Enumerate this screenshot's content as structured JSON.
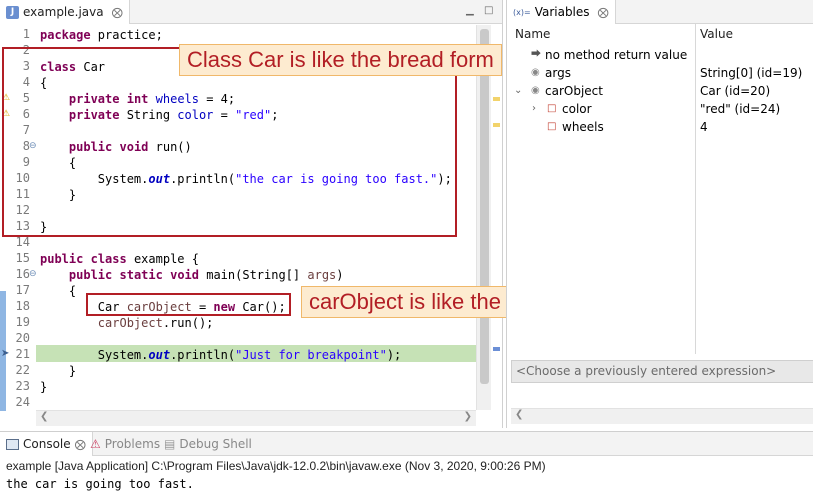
{
  "editor": {
    "tab_title": "example.java",
    "tab_close": "⨂",
    "line_numbers": [
      "1",
      "2",
      "3",
      "4",
      "5",
      "6",
      "7",
      "8",
      "9",
      "10",
      "11",
      "12",
      "13",
      "14",
      "15",
      "16",
      "17",
      "18",
      "19",
      "20",
      "21",
      "22",
      "23",
      "24"
    ],
    "code": {
      "l1": {
        "kw": "package",
        "rest": " practice;"
      },
      "l3": {
        "kw": "class",
        "rest": " Car"
      },
      "l4": {
        "text": "{"
      },
      "l5": {
        "kw1": "private",
        "kw2": "int",
        "fld": "wheels",
        "rest": " = 4;"
      },
      "l6": {
        "kw1": "private",
        "mid": " String ",
        "fld": "color",
        "eq": " = ",
        "str": "\"red\"",
        "end": ";"
      },
      "l8": {
        "kw1": "public",
        "kw2": "void",
        "rest": " run()"
      },
      "l9": {
        "text": "{"
      },
      "l10": {
        "pre": "System.",
        "sfld": "out",
        "mid": ".println(",
        "str": "\"the car is going too fast.\"",
        "end": ");"
      },
      "l11": {
        "text": "}"
      },
      "l13": {
        "text": "}"
      },
      "l15": {
        "kw1": "public",
        "kw2": "class",
        "rest": " example {"
      },
      "l16": {
        "kw1": "public",
        "kw2": "static",
        "kw3": "void",
        "mid": " main(String[] ",
        "lvar": "args",
        "end": ")"
      },
      "l17": {
        "text": "{"
      },
      "l18": {
        "pre": "Car ",
        "lvar": "carObject",
        "eq": " = ",
        "kw": "new",
        "end": " Car();"
      },
      "l19": {
        "lvar": "carObject",
        "end": ".run();"
      },
      "l21": {
        "pre": "System.",
        "sfld": "out",
        "mid": ".println(",
        "str": "\"Just for breakpoint\"",
        "end": ");"
      },
      "l22": {
        "text": "}"
      },
      "l23": {
        "text": "}"
      }
    },
    "annotations": {
      "class_label": "Class Car is like the bread form",
      "object_label": "carObject is like the bread"
    }
  },
  "variables": {
    "tab_title": "Variables",
    "tab_prefix": "(x)=",
    "col_name": "Name",
    "col_value": "Value",
    "rows": [
      {
        "name": "no method return value",
        "value": ""
      },
      {
        "name": "args",
        "value": "String[0]  (id=19)"
      },
      {
        "name": "carObject",
        "value": "Car  (id=20)"
      },
      {
        "name": "color",
        "value": "\"red\" (id=24)"
      },
      {
        "name": "wheels",
        "value": "4"
      }
    ],
    "expression_placeholder": "<Choose a previously entered expression>"
  },
  "console": {
    "tabs": [
      "Console",
      "Problems",
      "Debug Shell"
    ],
    "process_line": "example [Java Application] C:\\Program Files\\Java\\jdk-12.0.2\\bin\\javaw.exe  (Nov 3, 2020, 9:00:26 PM)",
    "output": "the car is going too fast."
  },
  "colors": {
    "annotation_red": "#b21e25",
    "annotation_bg": "#fdebd0",
    "debug_highlight": "#c6e2b6",
    "keyword": "#7f0055",
    "field": "#0000c0",
    "string": "#2a00ff"
  }
}
